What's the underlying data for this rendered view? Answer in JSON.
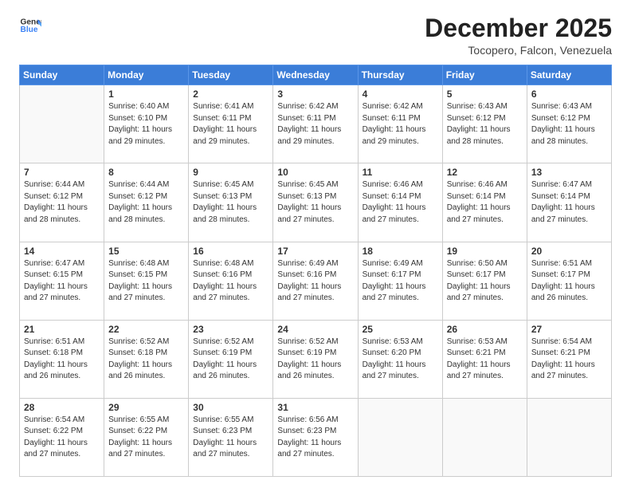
{
  "header": {
    "logo_general": "General",
    "logo_blue": "Blue",
    "month": "December 2025",
    "location": "Tocopero, Falcon, Venezuela"
  },
  "weekdays": [
    "Sunday",
    "Monday",
    "Tuesday",
    "Wednesday",
    "Thursday",
    "Friday",
    "Saturday"
  ],
  "weeks": [
    [
      {
        "day": "",
        "sunrise": "",
        "sunset": "",
        "daylight": ""
      },
      {
        "day": "1",
        "sunrise": "Sunrise: 6:40 AM",
        "sunset": "Sunset: 6:10 PM",
        "daylight": "Daylight: 11 hours and 29 minutes."
      },
      {
        "day": "2",
        "sunrise": "Sunrise: 6:41 AM",
        "sunset": "Sunset: 6:11 PM",
        "daylight": "Daylight: 11 hours and 29 minutes."
      },
      {
        "day": "3",
        "sunrise": "Sunrise: 6:42 AM",
        "sunset": "Sunset: 6:11 PM",
        "daylight": "Daylight: 11 hours and 29 minutes."
      },
      {
        "day": "4",
        "sunrise": "Sunrise: 6:42 AM",
        "sunset": "Sunset: 6:11 PM",
        "daylight": "Daylight: 11 hours and 29 minutes."
      },
      {
        "day": "5",
        "sunrise": "Sunrise: 6:43 AM",
        "sunset": "Sunset: 6:12 PM",
        "daylight": "Daylight: 11 hours and 28 minutes."
      },
      {
        "day": "6",
        "sunrise": "Sunrise: 6:43 AM",
        "sunset": "Sunset: 6:12 PM",
        "daylight": "Daylight: 11 hours and 28 minutes."
      }
    ],
    [
      {
        "day": "7",
        "sunrise": "Sunrise: 6:44 AM",
        "sunset": "Sunset: 6:12 PM",
        "daylight": "Daylight: 11 hours and 28 minutes."
      },
      {
        "day": "8",
        "sunrise": "Sunrise: 6:44 AM",
        "sunset": "Sunset: 6:12 PM",
        "daylight": "Daylight: 11 hours and 28 minutes."
      },
      {
        "day": "9",
        "sunrise": "Sunrise: 6:45 AM",
        "sunset": "Sunset: 6:13 PM",
        "daylight": "Daylight: 11 hours and 28 minutes."
      },
      {
        "day": "10",
        "sunrise": "Sunrise: 6:45 AM",
        "sunset": "Sunset: 6:13 PM",
        "daylight": "Daylight: 11 hours and 27 minutes."
      },
      {
        "day": "11",
        "sunrise": "Sunrise: 6:46 AM",
        "sunset": "Sunset: 6:14 PM",
        "daylight": "Daylight: 11 hours and 27 minutes."
      },
      {
        "day": "12",
        "sunrise": "Sunrise: 6:46 AM",
        "sunset": "Sunset: 6:14 PM",
        "daylight": "Daylight: 11 hours and 27 minutes."
      },
      {
        "day": "13",
        "sunrise": "Sunrise: 6:47 AM",
        "sunset": "Sunset: 6:14 PM",
        "daylight": "Daylight: 11 hours and 27 minutes."
      }
    ],
    [
      {
        "day": "14",
        "sunrise": "Sunrise: 6:47 AM",
        "sunset": "Sunset: 6:15 PM",
        "daylight": "Daylight: 11 hours and 27 minutes."
      },
      {
        "day": "15",
        "sunrise": "Sunrise: 6:48 AM",
        "sunset": "Sunset: 6:15 PM",
        "daylight": "Daylight: 11 hours and 27 minutes."
      },
      {
        "day": "16",
        "sunrise": "Sunrise: 6:48 AM",
        "sunset": "Sunset: 6:16 PM",
        "daylight": "Daylight: 11 hours and 27 minutes."
      },
      {
        "day": "17",
        "sunrise": "Sunrise: 6:49 AM",
        "sunset": "Sunset: 6:16 PM",
        "daylight": "Daylight: 11 hours and 27 minutes."
      },
      {
        "day": "18",
        "sunrise": "Sunrise: 6:49 AM",
        "sunset": "Sunset: 6:17 PM",
        "daylight": "Daylight: 11 hours and 27 minutes."
      },
      {
        "day": "19",
        "sunrise": "Sunrise: 6:50 AM",
        "sunset": "Sunset: 6:17 PM",
        "daylight": "Daylight: 11 hours and 27 minutes."
      },
      {
        "day": "20",
        "sunrise": "Sunrise: 6:51 AM",
        "sunset": "Sunset: 6:17 PM",
        "daylight": "Daylight: 11 hours and 26 minutes."
      }
    ],
    [
      {
        "day": "21",
        "sunrise": "Sunrise: 6:51 AM",
        "sunset": "Sunset: 6:18 PM",
        "daylight": "Daylight: 11 hours and 26 minutes."
      },
      {
        "day": "22",
        "sunrise": "Sunrise: 6:52 AM",
        "sunset": "Sunset: 6:18 PM",
        "daylight": "Daylight: 11 hours and 26 minutes."
      },
      {
        "day": "23",
        "sunrise": "Sunrise: 6:52 AM",
        "sunset": "Sunset: 6:19 PM",
        "daylight": "Daylight: 11 hours and 26 minutes."
      },
      {
        "day": "24",
        "sunrise": "Sunrise: 6:52 AM",
        "sunset": "Sunset: 6:19 PM",
        "daylight": "Daylight: 11 hours and 26 minutes."
      },
      {
        "day": "25",
        "sunrise": "Sunrise: 6:53 AM",
        "sunset": "Sunset: 6:20 PM",
        "daylight": "Daylight: 11 hours and 27 minutes."
      },
      {
        "day": "26",
        "sunrise": "Sunrise: 6:53 AM",
        "sunset": "Sunset: 6:21 PM",
        "daylight": "Daylight: 11 hours and 27 minutes."
      },
      {
        "day": "27",
        "sunrise": "Sunrise: 6:54 AM",
        "sunset": "Sunset: 6:21 PM",
        "daylight": "Daylight: 11 hours and 27 minutes."
      }
    ],
    [
      {
        "day": "28",
        "sunrise": "Sunrise: 6:54 AM",
        "sunset": "Sunset: 6:22 PM",
        "daylight": "Daylight: 11 hours and 27 minutes."
      },
      {
        "day": "29",
        "sunrise": "Sunrise: 6:55 AM",
        "sunset": "Sunset: 6:22 PM",
        "daylight": "Daylight: 11 hours and 27 minutes."
      },
      {
        "day": "30",
        "sunrise": "Sunrise: 6:55 AM",
        "sunset": "Sunset: 6:23 PM",
        "daylight": "Daylight: 11 hours and 27 minutes."
      },
      {
        "day": "31",
        "sunrise": "Sunrise: 6:56 AM",
        "sunset": "Sunset: 6:23 PM",
        "daylight": "Daylight: 11 hours and 27 minutes."
      },
      {
        "day": "",
        "sunrise": "",
        "sunset": "",
        "daylight": ""
      },
      {
        "day": "",
        "sunrise": "",
        "sunset": "",
        "daylight": ""
      },
      {
        "day": "",
        "sunrise": "",
        "sunset": "",
        "daylight": ""
      }
    ]
  ]
}
